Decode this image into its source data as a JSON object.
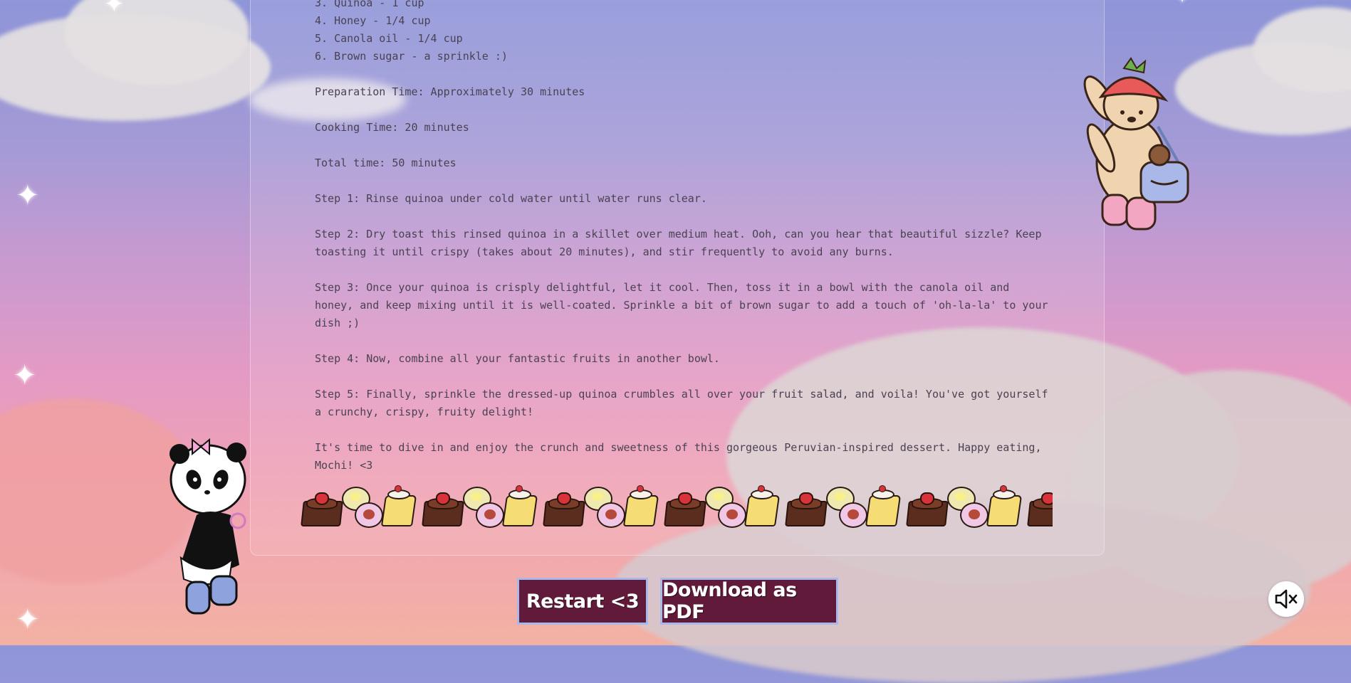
{
  "recipe": {
    "lines": [
      "3. Quinoa - 1 cup",
      "4. Honey - 1/4 cup",
      "5. Canola oil - 1/4 cup",
      "6. Brown sugar - a sprinkle :)",
      "",
      "Preparation Time: Approximately 30 minutes",
      "",
      "Cooking Time: 20 minutes",
      "",
      "Total time: 50 minutes",
      "",
      "Step 1: Rinse quinoa under cold water until water runs clear.",
      "",
      "Step 2: Dry toast this rinsed quinoa in a skillet over medium heat. Ooh, can you hear that beautiful sizzle? Keep",
      "toasting it until crispy (takes about 20 minutes), and stir frequently to avoid any burns.",
      "",
      "Step 3: Once your quinoa is crisply delightful, let it cool. Then, toss it in a bowl with the canola oil and",
      "honey, and keep mixing until it is well-coated. Sprinkle a bit of brown sugar to add a touch of 'oh-la-la' to your",
      "dish ;)",
      "",
      "Step 4: Now, combine all your fantastic fruits in another bowl.",
      "",
      "Step 5: Finally, sprinkle the dressed-up quinoa crumbles all over your fruit salad, and voila! You've got yourself",
      "a crunchy, crispy, fruity delight!",
      "",
      "It's time to dive in and enjoy the crunch and sweetness of this gorgeous Peruvian-inspired dessert. Happy eating,",
      "Mochi! <3"
    ]
  },
  "buttons": {
    "restart_label": "Restart <3",
    "pdf_label": "Download as PDF"
  },
  "icons": {
    "mute": "speaker-muted-icon",
    "decor": [
      "brownie-icon",
      "mochi-icon",
      "pudding-icon"
    ]
  },
  "colors": {
    "button_bg": "#621a3a",
    "button_border": "#a9b8e8",
    "text": "#4a4252"
  }
}
